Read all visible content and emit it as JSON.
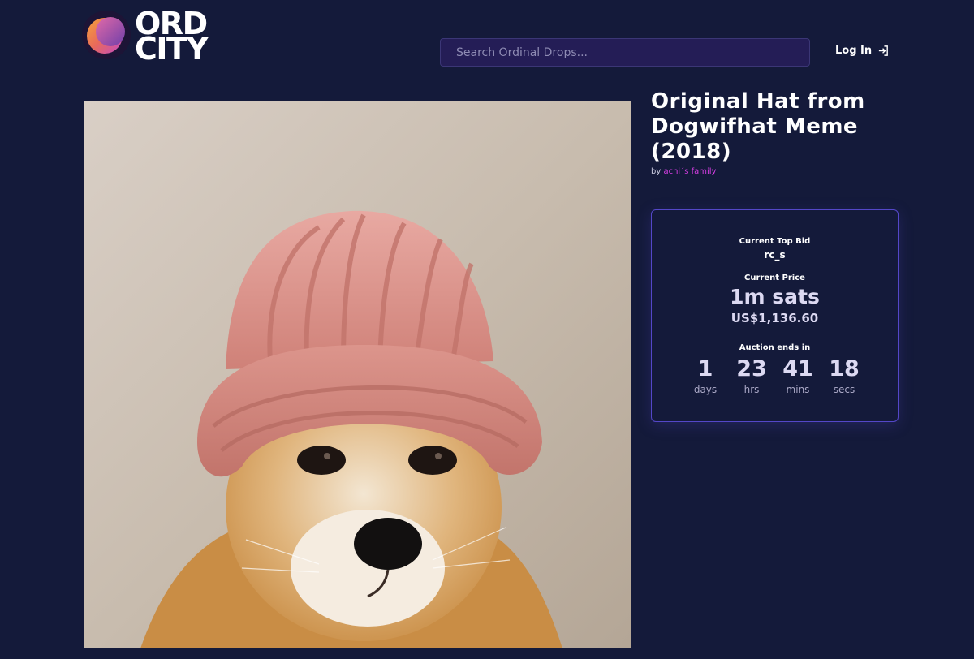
{
  "brand": {
    "name_line1": "ORD",
    "name_line2": "CITY",
    "logo_icon": "crescent-moon-logo"
  },
  "header": {
    "search_placeholder": "Search Ordinal Drops...",
    "login_label": "Log In",
    "login_icon": "sign-in-icon"
  },
  "artwork": {
    "alt": "Shiba inu dog wearing a pink knit hat"
  },
  "item": {
    "title": "Original Hat from Dogwifhat Meme (2018)",
    "by_prefix": "by",
    "creator": "achi´s family"
  },
  "auction": {
    "top_bid_label": "Current Top Bid",
    "top_bidder": "rc_s",
    "price_label": "Current Price",
    "price_sats": "1m sats",
    "price_usd": "US$1,136.60",
    "ends_label": "Auction ends in",
    "countdown": [
      {
        "value": "1",
        "unit": "days"
      },
      {
        "value": "23",
        "unit": "hrs"
      },
      {
        "value": "41",
        "unit": "mins"
      },
      {
        "value": "18",
        "unit": "secs"
      }
    ]
  },
  "colors": {
    "background": "#141a3a",
    "accent_border": "#5447c8",
    "creator_link": "#d93fe6",
    "search_bg": "#241d56"
  }
}
